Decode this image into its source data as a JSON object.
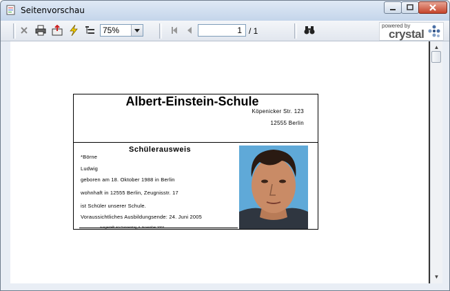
{
  "window": {
    "title": "Seitenvorschau",
    "app_icon": "report-preview-icon"
  },
  "toolbar": {
    "zoom_value": "75%",
    "current_page": "1",
    "page_total": "/ 1",
    "logo_small": "powered by",
    "logo_big": "crystal"
  },
  "card": {
    "school_name": "Albert-Einstein-Schule",
    "address_street": "Köpenicker Str. 123",
    "address_city": "12555  Berlin",
    "id_title": "Schülerausweis",
    "last_name": "*Börne",
    "first_name": "Ludwig",
    "birth": "geboren am 18. Oktober 1988 in Berlin",
    "residence": "wohnhaft in 12555 Berlin, Zeugnisstr. 17",
    "status": "ist Schüler unserer Schule.",
    "graduation": "Voraussichtliches Ausbildungsende: 24. Juni 2005",
    "issued": "ausgestellt am Donnerstag, 6. November 2003"
  }
}
